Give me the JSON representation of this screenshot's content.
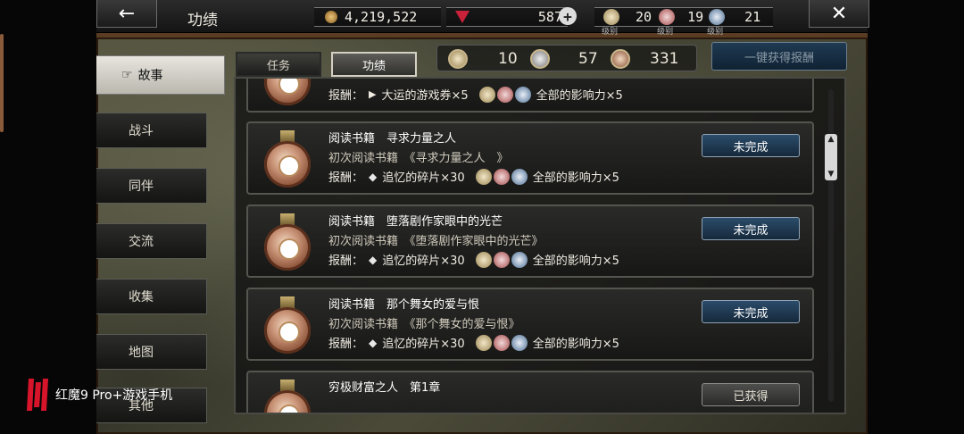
{
  "header": {
    "title": "功绩",
    "gold": "4,219,522",
    "gems": "587",
    "medal_tier1": {
      "count": "20",
      "label": "级别"
    },
    "medal_tier2": {
      "count": "19",
      "label": "级别"
    },
    "medal_tier3": {
      "count": "21",
      "label": "级别"
    }
  },
  "sidebar": {
    "items": [
      {
        "label": "故事"
      },
      {
        "label": "战斗"
      },
      {
        "label": "同伴"
      },
      {
        "label": "交流"
      },
      {
        "label": "收集"
      },
      {
        "label": "地图"
      },
      {
        "label": "其他"
      }
    ]
  },
  "tabs": [
    {
      "label": "任务"
    },
    {
      "label": "功绩"
    }
  ],
  "medal_counts": {
    "gold": "10",
    "silver": "57",
    "bronze": "331"
  },
  "claim_all_label": "一键获得报酬",
  "achievements": [
    {
      "title": "",
      "subtitle": "",
      "reward_prefix": "报酬：",
      "reward_item": "大运的游戏券×5",
      "reward_extra": "全部的影响力×5",
      "status": ""
    },
    {
      "title": "阅读书籍　寻求力量之人",
      "subtitle": "初次阅读书籍　《寻求力量之人　》",
      "reward_prefix": "报酬：",
      "reward_item": "追忆的碎片×30",
      "reward_extra": "全部的影响力×5",
      "status": "未完成"
    },
    {
      "title": "阅读书籍　堕落剧作家眼中的光芒",
      "subtitle": "初次阅读书籍　《堕落剧作家眼中的光芒》",
      "reward_prefix": "报酬：",
      "reward_item": "追忆的碎片×30",
      "reward_extra": "全部的影响力×5",
      "status": "未完成"
    },
    {
      "title": "阅读书籍　那个舞女的爱与恨",
      "subtitle": "初次阅读书籍　《那个舞女的爱与恨》",
      "reward_prefix": "报酬：",
      "reward_item": "追忆的碎片×30",
      "reward_extra": "全部的影响力×5",
      "status": "未完成"
    },
    {
      "title": "穷极财富之人　第1章",
      "subtitle": "",
      "reward_prefix": "",
      "reward_item": "",
      "reward_extra": "",
      "status": "已获得"
    }
  ],
  "watermark": "红魔9 Pro+游戏手机",
  "colors": {
    "accent_blue": "#2b4c6a",
    "medal_bronze": "#c89276"
  }
}
